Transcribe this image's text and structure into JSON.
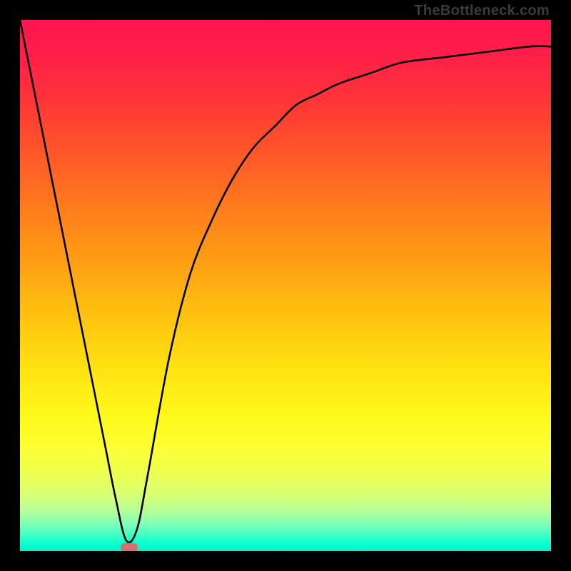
{
  "watermark": "TheBottleneck.com",
  "chart_data": {
    "type": "line",
    "title": "",
    "xlabel": "",
    "ylabel": "",
    "xlim": [
      0,
      100
    ],
    "ylim": [
      0,
      100
    ],
    "grid": false,
    "legend": false,
    "series": [
      {
        "name": "bottleneck-curve",
        "x": [
          0,
          4,
          8,
          12,
          16,
          18,
          20,
          22,
          24,
          28,
          32,
          36,
          40,
          44,
          48,
          52,
          56,
          60,
          66,
          72,
          80,
          88,
          96,
          100
        ],
        "y": [
          100,
          80,
          60,
          40,
          20,
          10,
          2,
          4,
          14,
          36,
          52,
          62,
          70,
          76,
          80,
          84,
          86,
          88,
          90,
          92,
          93,
          94,
          95,
          95
        ]
      }
    ],
    "marker": {
      "x": 20.5,
      "y": 0.7
    },
    "background_gradient_stops": [
      {
        "pos": 0.0,
        "color": "#ff1450"
      },
      {
        "pos": 0.15,
        "color": "#ff3438"
      },
      {
        "pos": 0.36,
        "color": "#ff7e1c"
      },
      {
        "pos": 0.56,
        "color": "#ffc310"
      },
      {
        "pos": 0.74,
        "color": "#fff81a"
      },
      {
        "pos": 0.89,
        "color": "#d8ff74"
      },
      {
        "pos": 1.0,
        "color": "#00f2c8"
      }
    ]
  }
}
